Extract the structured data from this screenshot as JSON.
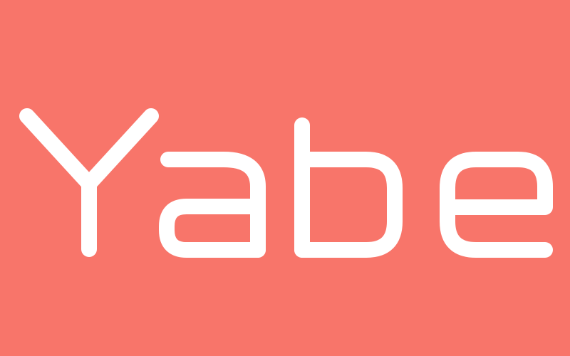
{
  "logo": {
    "text": "Yabe",
    "text_color": "#ffffff",
    "background_color": "#f8756a"
  }
}
